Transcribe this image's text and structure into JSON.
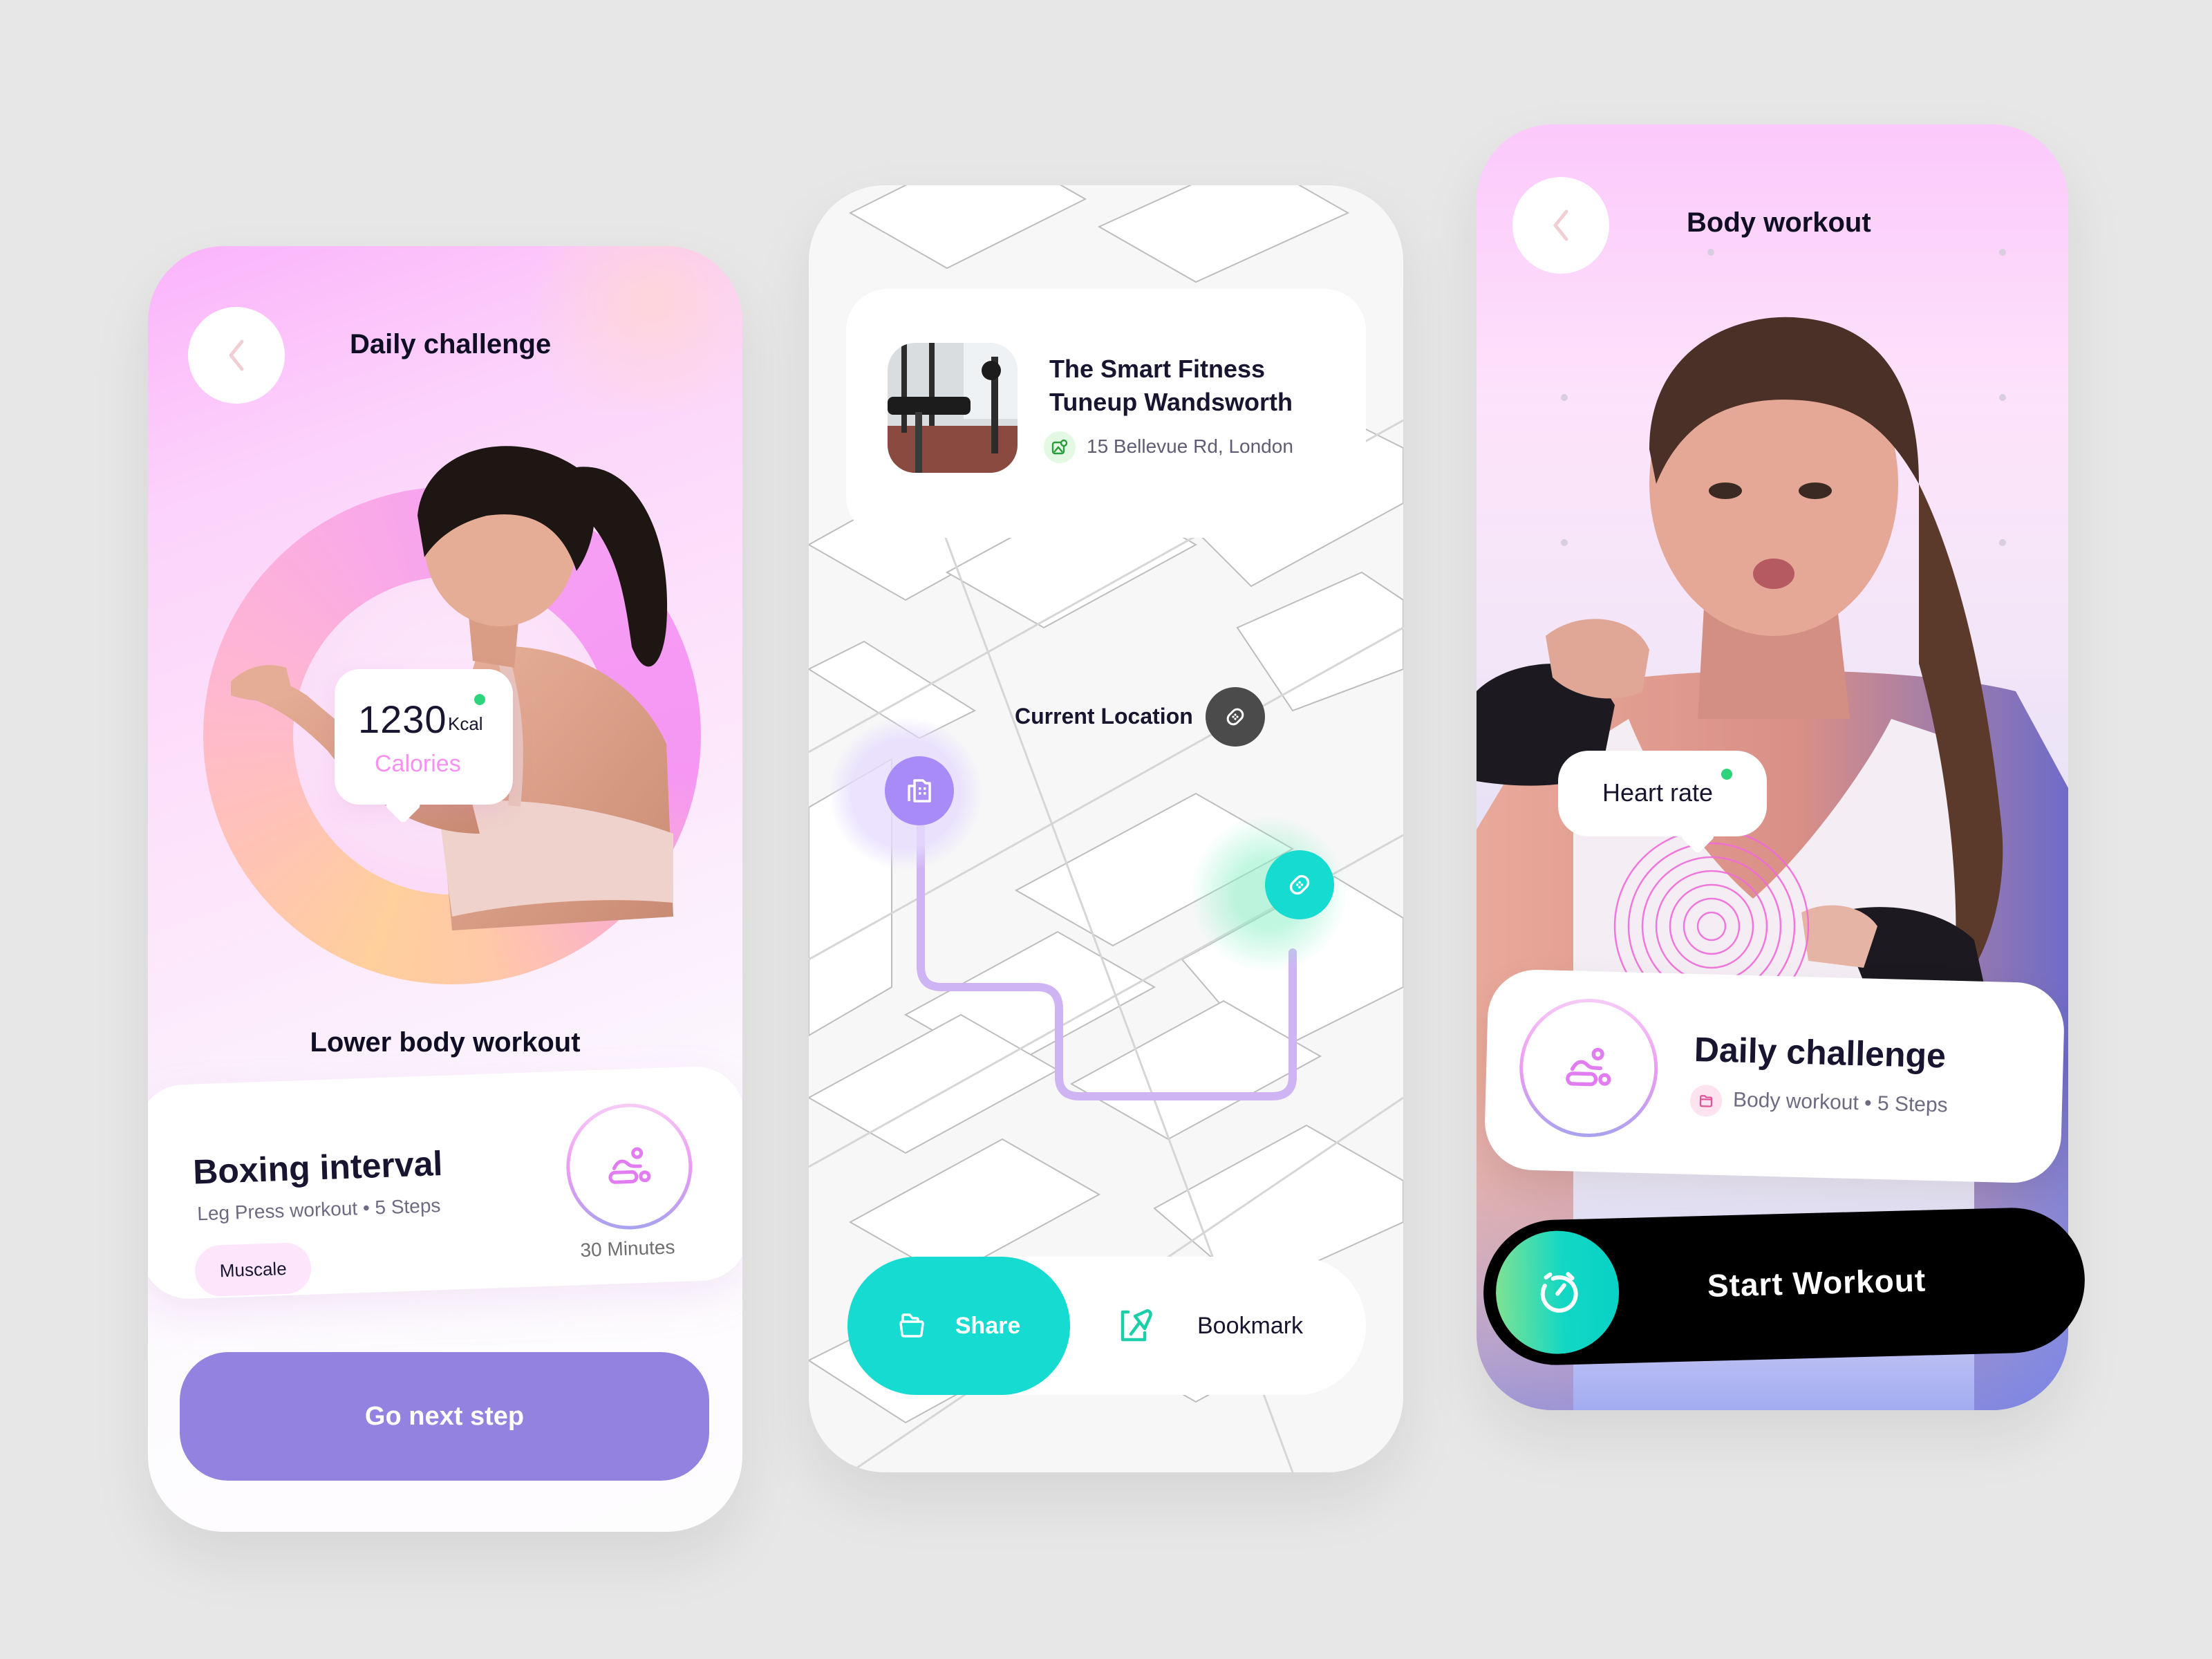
{
  "colors": {
    "background": "#e7e7e7",
    "text_primary": "#0f0e24",
    "accent_purple": "#9382df",
    "accent_pink": "#f790f2",
    "accent_teal": "#16dbd1",
    "status_green": "#2ed47a",
    "pin_purple": "#a98bf7",
    "pin_dark": "#4b4b4b"
  },
  "daily_challenge_screen": {
    "title": "Daily challenge",
    "back_icon": "chevron-left-icon",
    "calories": {
      "value": "1230",
      "unit": "Kcal",
      "label": "Calories",
      "status": "active"
    },
    "section_title": "Lower body workout",
    "workout_card": {
      "title": "Boxing interval",
      "meta": "Leg Press workout • 5 Steps",
      "tag": "Muscale",
      "icon": "exercise-icon",
      "duration": "30 Minutes"
    },
    "next_button": "Go next step"
  },
  "map_screen": {
    "gym_card": {
      "name_line1": "The Smart Fitness",
      "name_line2": "Tuneup Wandsworth",
      "address_icon": "map-pin-image-icon",
      "address": "15 Bellevue Rd, London"
    },
    "current_location_label": "Current Location",
    "pins": [
      {
        "name": "current-location",
        "icon": "bandage-icon"
      },
      {
        "name": "gym",
        "icon": "building-icon"
      },
      {
        "name": "destination",
        "icon": "bandage-icon"
      }
    ],
    "actions": {
      "share_label": "Share",
      "share_icon": "folder-open-icon",
      "bookmark_label": "Bookmark",
      "bookmark_icon": "bookmark-pin-icon"
    }
  },
  "body_workout_screen": {
    "title": "Body workout",
    "back_icon": "chevron-left-icon",
    "heart_rate_label": "Heart rate",
    "heart_rate_status": "active",
    "challenge_card": {
      "title": "Daily challenge",
      "meta_icon": "folder-icon",
      "meta": "Body workout • 5 Steps",
      "icon": "exercise-icon"
    },
    "start_button": {
      "label": "Start Workout",
      "icon": "stopwatch-icon"
    }
  }
}
